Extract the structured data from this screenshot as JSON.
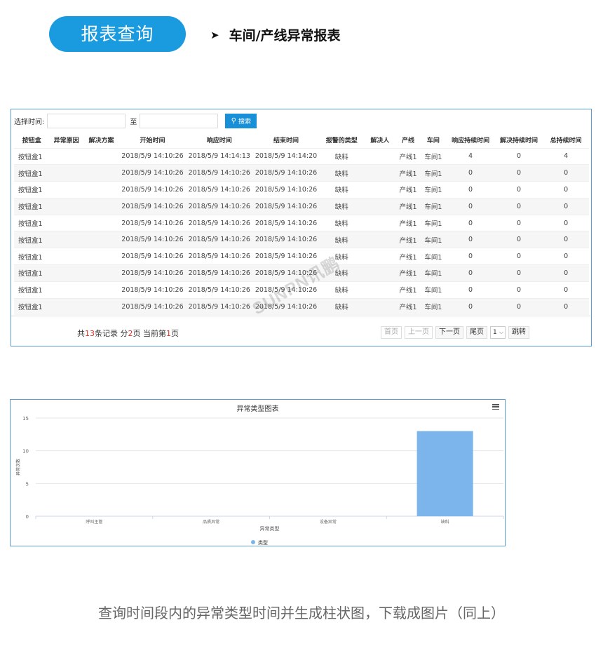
{
  "header": {
    "pill_label": "报表查询",
    "title": "车间/产线异常报表"
  },
  "filter": {
    "time_label": "选择时间:",
    "to_label": "至",
    "start_value": "",
    "end_value": "",
    "search_label": "搜索"
  },
  "table": {
    "columns": [
      "按钮盒",
      "异常原因",
      "解决方案",
      "开始时间",
      "响应时间",
      "结束时间",
      "报警的类型",
      "解决人",
      "产线",
      "车间",
      "响应持续时间",
      "解决持续时间",
      "总持续时间"
    ],
    "rows": [
      [
        "按钮盒1",
        "",
        "",
        "2018/5/9 14:10:26",
        "2018/5/9 14:14:13",
        "2018/5/9 14:14:20",
        "缺料",
        "",
        "产线1",
        "车间1",
        "4",
        "0",
        "4"
      ],
      [
        "按钮盒1",
        "",
        "",
        "2018/5/9 14:10:26",
        "2018/5/9 14:10:26",
        "2018/5/9 14:10:26",
        "缺料",
        "",
        "产线1",
        "车间1",
        "0",
        "0",
        "0"
      ],
      [
        "按钮盒1",
        "",
        "",
        "2018/5/9 14:10:26",
        "2018/5/9 14:10:26",
        "2018/5/9 14:10:26",
        "缺料",
        "",
        "产线1",
        "车间1",
        "0",
        "0",
        "0"
      ],
      [
        "按钮盒1",
        "",
        "",
        "2018/5/9 14:10:26",
        "2018/5/9 14:10:26",
        "2018/5/9 14:10:26",
        "缺料",
        "",
        "产线1",
        "车间1",
        "0",
        "0",
        "0"
      ],
      [
        "按钮盒1",
        "",
        "",
        "2018/5/9 14:10:26",
        "2018/5/9 14:10:26",
        "2018/5/9 14:10:26",
        "缺料",
        "",
        "产线1",
        "车间1",
        "0",
        "0",
        "0"
      ],
      [
        "按钮盒1",
        "",
        "",
        "2018/5/9 14:10:26",
        "2018/5/9 14:10:26",
        "2018/5/9 14:10:26",
        "缺料",
        "",
        "产线1",
        "车间1",
        "0",
        "0",
        "0"
      ],
      [
        "按钮盒1",
        "",
        "",
        "2018/5/9 14:10:26",
        "2018/5/9 14:10:26",
        "2018/5/9 14:10:26",
        "缺料",
        "",
        "产线1",
        "车间1",
        "0",
        "0",
        "0"
      ],
      [
        "按钮盒1",
        "",
        "",
        "2018/5/9 14:10:26",
        "2018/5/9 14:10:26",
        "2018/5/9 14:10:26",
        "缺料",
        "",
        "产线1",
        "车间1",
        "0",
        "0",
        "0"
      ],
      [
        "按钮盒1",
        "",
        "",
        "2018/5/9 14:10:26",
        "2018/5/9 14:10:26",
        "2018/5/9 14:10:26",
        "缺料",
        "",
        "产线1",
        "车间1",
        "0",
        "0",
        "0"
      ],
      [
        "按钮盒1",
        "",
        "",
        "2018/5/9 14:10:26",
        "2018/5/9 14:10:26",
        "2018/5/9 14:10:26",
        "缺料",
        "",
        "产线1",
        "车间1",
        "0",
        "0",
        "0"
      ]
    ]
  },
  "pagination": {
    "summary_prefix": "共",
    "total_records": "13",
    "summary_mid1": "条记录 分",
    "total_pages": "2",
    "summary_mid2": "页 当前第",
    "current_page": "1",
    "summary_suffix": "页",
    "first": "首页",
    "prev": "上一页",
    "next": "下一页",
    "last": "尾页",
    "page_select": "1",
    "jump": "跳转"
  },
  "watermark": "SUNPN讯鹏",
  "chart_data": {
    "type": "bar",
    "title": "异常类型图表",
    "categories": [
      "呼叫主管",
      "品质异常",
      "设备异常",
      "缺料"
    ],
    "series": [
      {
        "name": "类型",
        "values": [
          0,
          0,
          0,
          13
        ],
        "color": "#7cb5ec"
      }
    ],
    "xlabel": "异常类型",
    "ylabel": "异常次数",
    "ylim": [
      0,
      15
    ],
    "yticks": [
      0,
      5,
      10,
      15
    ],
    "grid": true,
    "legend": "bottom"
  },
  "caption": "查询时间段内的异常类型时间并生成柱状图，下载成图片（同上）"
}
